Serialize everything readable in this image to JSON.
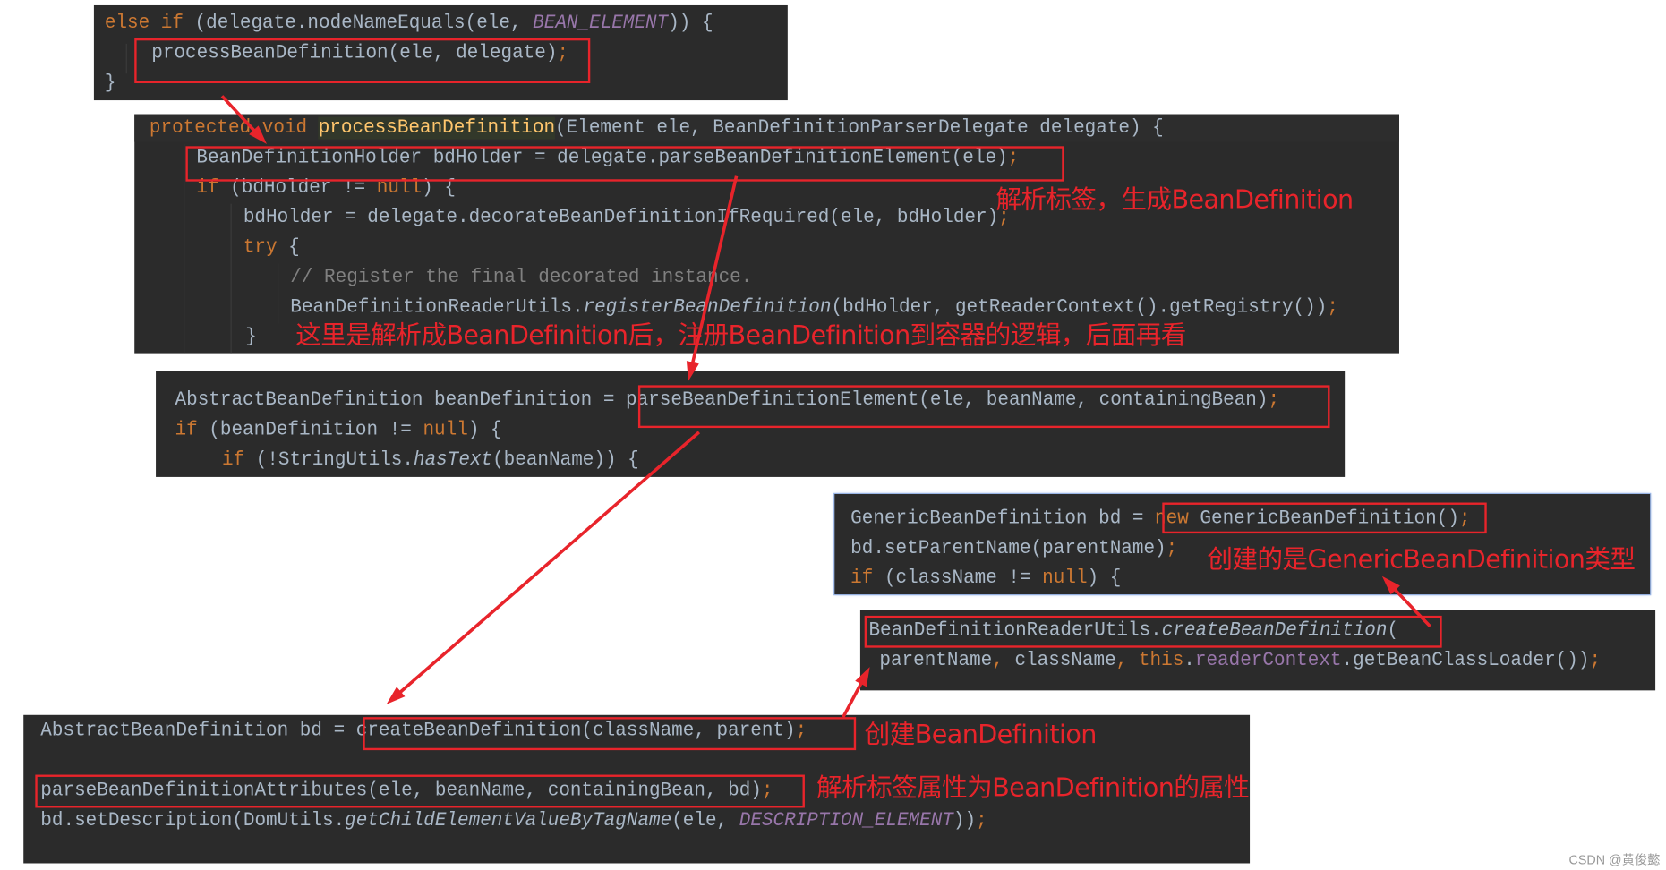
{
  "colors": {
    "background": "#2b2b2b",
    "keyword": "#cc7832",
    "text": "#a9b7c6",
    "constant": "#9876aa",
    "method_declaration": "#ffc66d",
    "comment": "#808080",
    "highlight": "#e8242b"
  },
  "panels": [
    {
      "lines": [
        [
          [
            "else if ",
            "kw"
          ],
          [
            "(delegate.nodeNameEquals(ele, ",
            "txt"
          ],
          [
            "BEAN_ELEMENT",
            "const"
          ],
          [
            ")) {",
            "txt"
          ]
        ],
        [
          [
            "processBeanDefinition(ele, delegate)",
            "txt"
          ],
          [
            ";",
            "kw"
          ]
        ],
        [
          [
            "}",
            "txt"
          ]
        ]
      ]
    },
    {
      "lines": [
        [
          [
            "protected void ",
            "kw"
          ],
          [
            "processBeanDefinition",
            "decl"
          ],
          [
            "(Element ele, BeanDefinitionParserDelegate delegate) {",
            "txt"
          ]
        ],
        [
          [
            "BeanDefinitionHolder bdHolder = delegate.parseBeanDefinitionElement(ele)",
            "txt"
          ],
          [
            ";",
            "kw"
          ]
        ],
        [
          [
            "if ",
            "kw"
          ],
          [
            "(bdHolder != ",
            "txt"
          ],
          [
            "null",
            "kw"
          ],
          [
            ") {",
            "txt"
          ]
        ],
        [
          [
            "bdHolder = delegate.decorateBeanDefinitionIfRequired(ele, bdHolder)",
            "txt"
          ],
          [
            ";",
            "kw"
          ]
        ],
        [
          [
            "try ",
            "kw"
          ],
          [
            "{",
            "txt"
          ]
        ],
        [
          [
            "// Register the final decorated instance.",
            "cmt"
          ]
        ],
        [
          [
            "BeanDefinitionReaderUtils.",
            "txt"
          ],
          [
            "registerBeanDefinition",
            "it"
          ],
          [
            "(bdHolder, getReaderContext().getRegistry())",
            "txt"
          ],
          [
            ";",
            "kw"
          ]
        ],
        [
          [
            "}",
            "txt"
          ]
        ]
      ]
    },
    {
      "lines": [
        [
          [
            "AbstractBeanDefinition beanDefinition = parseBeanDefinitionElement(ele, beanName, containingBean)",
            "txt"
          ],
          [
            ";",
            "kw"
          ]
        ],
        [
          [
            "if ",
            "kw"
          ],
          [
            "(beanDefinition != ",
            "txt"
          ],
          [
            "null",
            "kw"
          ],
          [
            ") {",
            "txt"
          ]
        ],
        [
          [
            "if ",
            "kw"
          ],
          [
            "(!StringUtils.",
            "txt"
          ],
          [
            "hasText",
            "it"
          ],
          [
            "(beanName)) {",
            "txt"
          ]
        ]
      ]
    },
    {
      "lines": [
        [
          [
            "GenericBeanDefinition bd = ",
            "txt"
          ],
          [
            "new ",
            "kw"
          ],
          [
            "GenericBeanDefinition()",
            "txt"
          ],
          [
            ";",
            "kw"
          ]
        ],
        [
          [
            "bd.setParentName(parentName)",
            "txt"
          ],
          [
            ";",
            "kw"
          ]
        ],
        [
          [
            "if ",
            "kw"
          ],
          [
            "(className != ",
            "txt"
          ],
          [
            "null",
            "kw"
          ],
          [
            ") {",
            "txt"
          ]
        ]
      ]
    },
    {
      "lines": [
        [
          [
            "BeanDefinitionReaderUtils.",
            "txt"
          ],
          [
            "createBeanDefinition",
            "it"
          ],
          [
            "(",
            "txt"
          ]
        ],
        [
          [
            "parentName",
            "txt"
          ],
          [
            ", ",
            "kw"
          ],
          [
            "className",
            "txt"
          ],
          [
            ", ",
            "kw"
          ],
          [
            "this",
            "kw"
          ],
          [
            ".",
            "txt"
          ],
          [
            "readerContext",
            "field"
          ],
          [
            ".getBeanClassLoader())",
            "txt"
          ],
          [
            ";",
            "kw"
          ]
        ]
      ]
    },
    {
      "lines": [
        [
          [
            "AbstractBeanDefinition bd = createBeanDefinition(className, parent)",
            "txt"
          ],
          [
            ";",
            "kw"
          ]
        ],
        [
          [
            "parseBeanDefinitionAttributes(ele, beanName, containingBean, bd)",
            "txt"
          ],
          [
            ";",
            "kw"
          ]
        ],
        [
          [
            "bd.setDescription(DomUtils.",
            "txt"
          ],
          [
            "getChildElementValueByTagName",
            "it"
          ],
          [
            "(ele, ",
            "txt"
          ],
          [
            "DESCRIPTION_ELEMENT",
            "const"
          ],
          [
            "))",
            "txt"
          ],
          [
            ";",
            "kw"
          ]
        ]
      ]
    }
  ],
  "annotations": {
    "parse_tag": "解析标签，生成BeanDefinition",
    "register_note": "这里是解析成BeanDefinition后，注册BeanDefinition到容器的逻辑，后面再看",
    "generic_type": "创建的是GenericBeanDefinition类型",
    "create_bd": "创建BeanDefinition",
    "parse_attrs": "解析标签属性为BeanDefinition的属性"
  },
  "watermark": "CSDN @黄俊懿"
}
